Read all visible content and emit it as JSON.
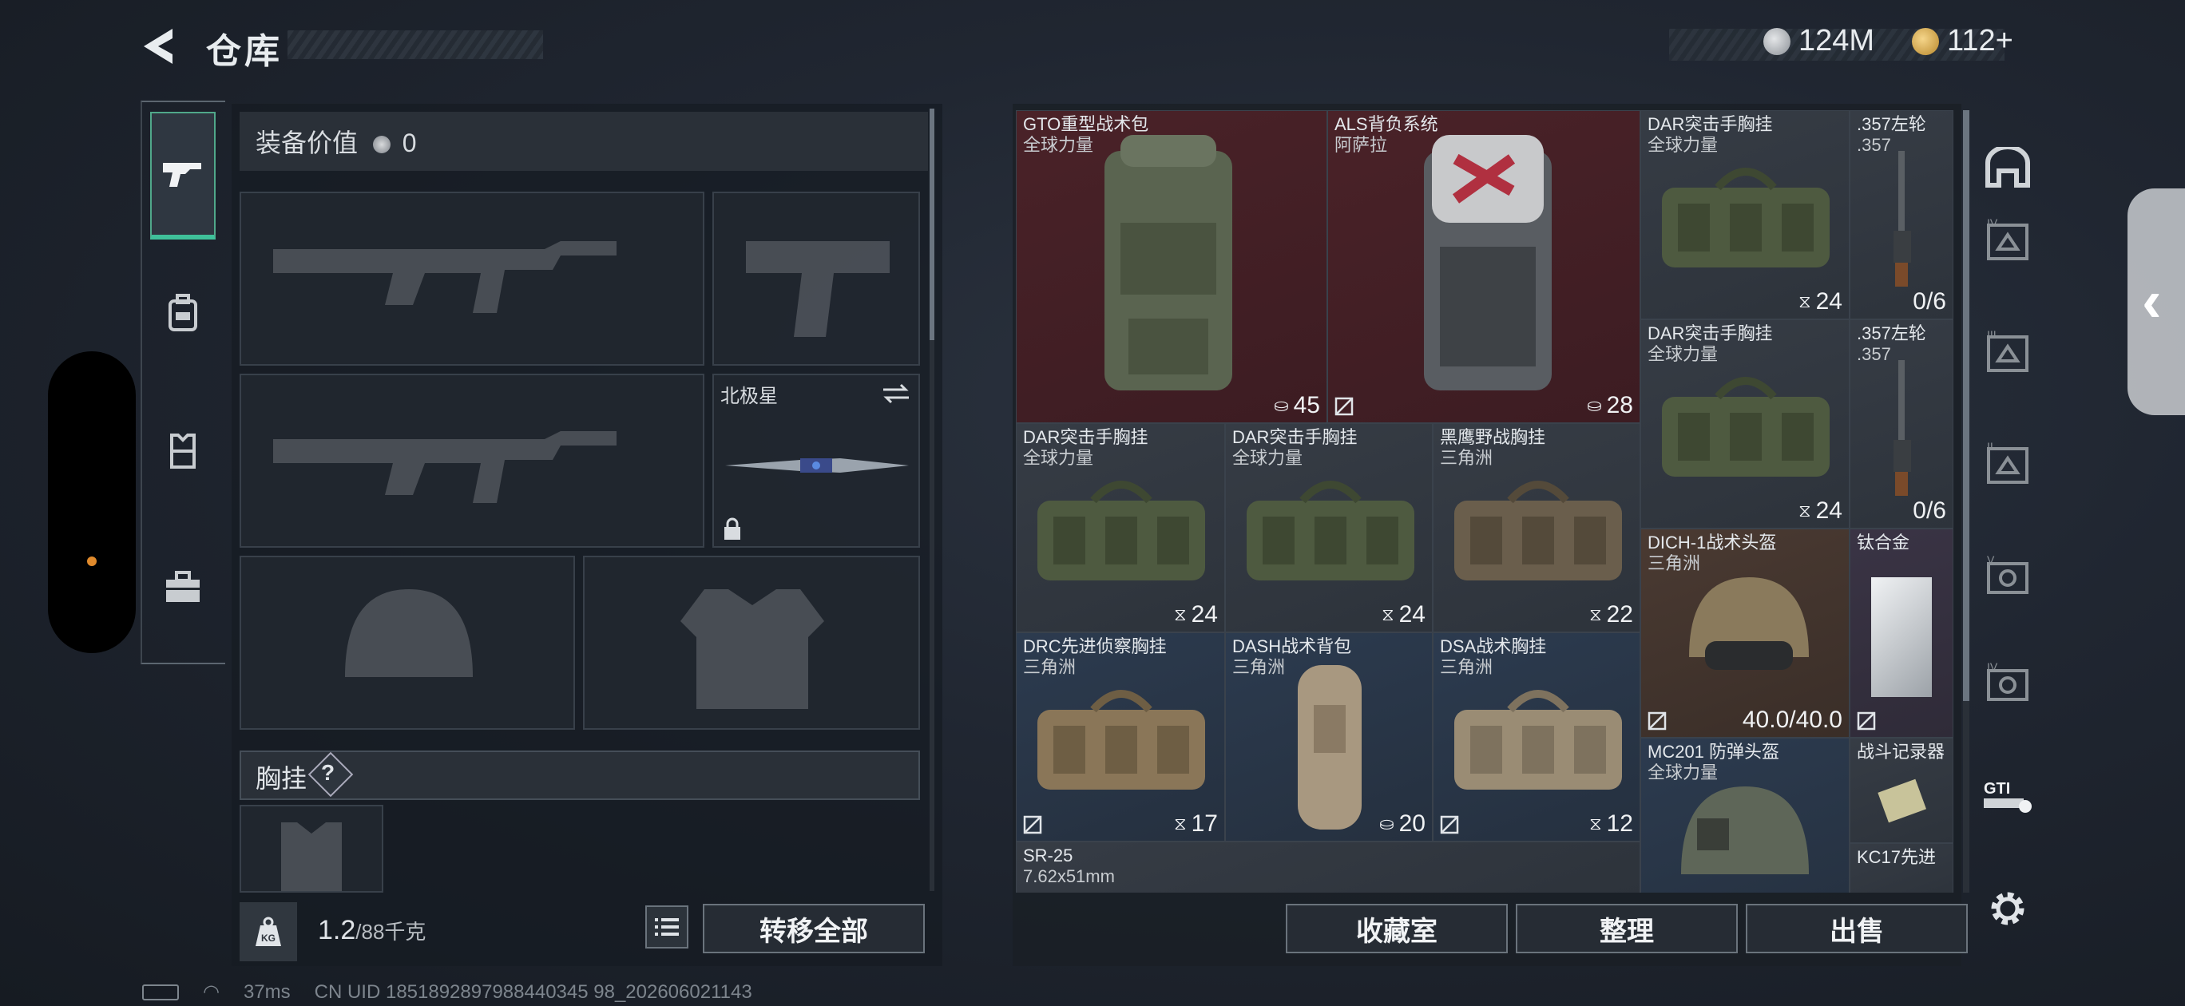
{
  "header": {
    "title": "仓库"
  },
  "currency": {
    "coins": "124M",
    "premium": "112+"
  },
  "left_panel": {
    "equipment_value_label": "装备价值",
    "equipment_value": "0",
    "melee_slot_name": "北极星",
    "chest_rig_label": "胸挂",
    "chest_rig_help": "?",
    "weight_value": "1.2",
    "weight_unit": "/88千克",
    "transfer_all_label": "转移全部"
  },
  "left_tabs": [
    "firearm-icon",
    "backpack-icon",
    "vest-icon",
    "toolbox-icon"
  ],
  "inventory": [
    {
      "name": "GTO重型战术包",
      "sub": "全球力量",
      "count": "45",
      "count_icon": "backpack-small-icon",
      "color": "red"
    },
    {
      "name": "ALS背负系统",
      "sub": "阿萨拉",
      "count": "28",
      "count_icon": "backpack-small-icon",
      "color": "red"
    },
    {
      "name": "DAR突击手胸挂",
      "sub": "全球力量",
      "count": "24",
      "count_icon": "vest-small-icon",
      "color": "gray"
    },
    {
      "name": ".357左轮",
      "sub": ".357",
      "count": "0/6",
      "color": "gray"
    },
    {
      "name": "DAR突击手胸挂",
      "sub": "全球力量",
      "count": "24",
      "count_icon": "vest-small-icon",
      "color": "gray"
    },
    {
      "name": ".357左轮",
      "sub": ".357",
      "count": "0/6",
      "color": "gray"
    },
    {
      "name": "DAR突击手胸挂",
      "sub": "全球力量",
      "count": "24",
      "count_icon": "vest-small-icon",
      "color": "gray"
    },
    {
      "name": "DAR突击手胸挂",
      "sub": "全球力量",
      "count": "24",
      "count_icon": "vest-small-icon",
      "color": "gray"
    },
    {
      "name": "黑鹰野战胸挂",
      "sub": "三角洲",
      "count": "22",
      "count_icon": "vest-small-icon",
      "color": "gray"
    },
    {
      "name": "DICH-1战术头盔",
      "sub": "三角洲",
      "count": "40.0/40.0",
      "color": "brown"
    },
    {
      "name": "钛合金",
      "sub": "",
      "count": "",
      "color": "purp"
    },
    {
      "name": "DRC先进侦察胸挂",
      "sub": "三角洲",
      "count": "17",
      "count_icon": "vest-small-icon",
      "color": "blue"
    },
    {
      "name": "DASH战术背包",
      "sub": "三角洲",
      "count": "20",
      "count_icon": "backpack-small-icon",
      "color": "blue"
    },
    {
      "name": "DSA战术胸挂",
      "sub": "三角洲",
      "count": "12",
      "count_icon": "vest-small-icon",
      "color": "blue"
    },
    {
      "name": "MC201 防弹头盔",
      "sub": "全球力量",
      "count": "",
      "color": "blue"
    },
    {
      "name": "战斗记录器",
      "sub": "",
      "count": "",
      "color": "gray"
    },
    {
      "name": "SR-25",
      "sub": "7.62x51mm",
      "count": "",
      "color": "gray"
    },
    {
      "name": "KC17先进",
      "sub": "",
      "count": "",
      "color": "gray"
    }
  ],
  "right_filters": [
    "all-items-icon",
    "armor-iv-icon",
    "armor-iii-icon",
    "armor-ii-icon",
    "helmet-v-icon",
    "helmet-iv-icon",
    "gti-icon",
    "settings-icon"
  ],
  "actions": {
    "collection": "收藏室",
    "sort": "整理",
    "sell": "出售"
  },
  "status_bar": {
    "ping": "37ms",
    "uid": "CN UID 1851892897988440345 98_202606021143"
  }
}
